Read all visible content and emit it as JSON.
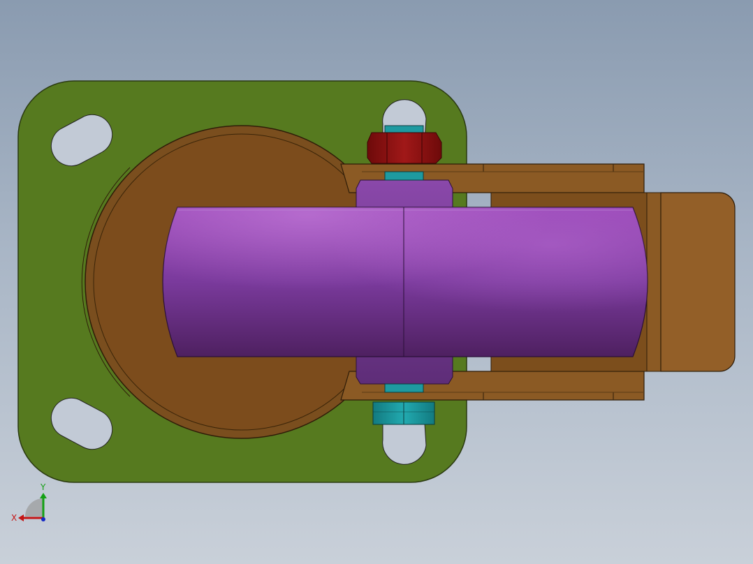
{
  "viewport": {
    "background_top": "#8a9bb0",
    "background_bottom": "#c9d0d9"
  },
  "model": {
    "parts": [
      {
        "name": "mounting-plate",
        "color": "#567a1f"
      },
      {
        "name": "swivel-housing",
        "color": "#7a4e1e"
      },
      {
        "name": "fork-bracket",
        "color": "#8b5a24"
      },
      {
        "name": "wheel",
        "color": "#8a3fa6"
      },
      {
        "name": "wheel-hub",
        "color": "#7b3f9e"
      },
      {
        "name": "axle-bolt",
        "color": "#1e9aa0"
      },
      {
        "name": "nut-top",
        "color": "#8e1010"
      },
      {
        "name": "nut-bottom",
        "color": "#1a9aa0"
      }
    ]
  },
  "triad": {
    "x_label": "X",
    "y_label": "Y",
    "x_color": "#c41414",
    "y_color": "#14a014"
  }
}
